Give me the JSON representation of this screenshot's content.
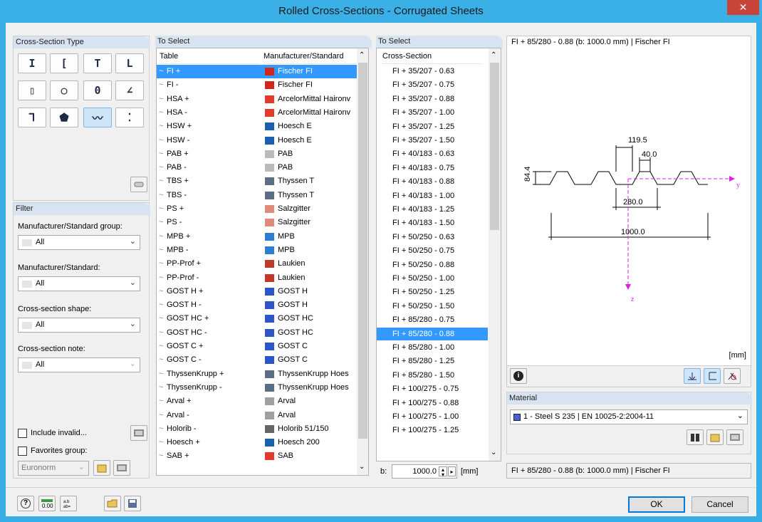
{
  "window": {
    "title": "Rolled Cross-Sections - Corrugated Sheets",
    "close": "✕"
  },
  "cross_section_type": {
    "header": "Cross-Section Type",
    "shapes": [
      "I-section",
      "channel-section",
      "tee-section",
      "angle-section",
      "rect-hollow-section",
      "circle-hollow-section",
      "round-bar-section",
      "unequal-angle-section",
      "z-section",
      "special-section",
      "corrugated-section",
      "stacked-section"
    ],
    "selected": "corrugated-section"
  },
  "filter": {
    "header": "Filter",
    "group_label": "Manufacturer/Standard group:",
    "group_value": "All",
    "mfr_label": "Manufacturer/Standard:",
    "mfr_value": "All",
    "shape_label": "Cross-section shape:",
    "shape_value": "All",
    "note_label": "Cross-section note:",
    "note_value": "All",
    "include_invalid": "Include invalid...",
    "favorites": "Favorites group:",
    "favorites_value": "Euronorm"
  },
  "tables": {
    "header": "To Select",
    "col1": "Table",
    "col2": "Manufacturer/Standard",
    "rows": [
      {
        "t": "FI +",
        "m": "Fischer FI",
        "c": "#d2261c"
      },
      {
        "t": "FI -",
        "m": "Fischer FI",
        "c": "#d2261c"
      },
      {
        "t": "HSA +",
        "m": "ArcelorMittal Haironv",
        "c": "#e23a2c"
      },
      {
        "t": "HSA -",
        "m": "ArcelorMittal Haironv",
        "c": "#e23a2c"
      },
      {
        "t": "HSW +",
        "m": "Hoesch E",
        "c": "#1b5fb0"
      },
      {
        "t": "HSW -",
        "m": "Hoesch E",
        "c": "#1b5fb0"
      },
      {
        "t": "PAB +",
        "m": "PAB",
        "c": "#bbbbbb"
      },
      {
        "t": "PAB -",
        "m": "PAB",
        "c": "#bbbbbb"
      },
      {
        "t": "TBS +",
        "m": "Thyssen T",
        "c": "#5a6e86"
      },
      {
        "t": "TBS -",
        "m": "Thyssen T",
        "c": "#5a6e86"
      },
      {
        "t": "PS +",
        "m": "Salzgitter",
        "c": "#e08a7a"
      },
      {
        "t": "PS -",
        "m": "Salzgitter",
        "c": "#e08a7a"
      },
      {
        "t": "MPB +",
        "m": "MPB",
        "c": "#2c7fd0"
      },
      {
        "t": "MPB -",
        "m": "MPB",
        "c": "#2c7fd0"
      },
      {
        "t": "PP-Prof +",
        "m": "Laukien",
        "c": "#c0392b"
      },
      {
        "t": "PP-Prof -",
        "m": "Laukien",
        "c": "#c0392b"
      },
      {
        "t": "GOST H +",
        "m": "GOST H",
        "c": "#2f56c6"
      },
      {
        "t": "GOST H -",
        "m": "GOST H",
        "c": "#2f56c6"
      },
      {
        "t": "GOST HC +",
        "m": "GOST HC",
        "c": "#2f56c6"
      },
      {
        "t": "GOST HC -",
        "m": "GOST HC",
        "c": "#2f56c6"
      },
      {
        "t": "GOST C +",
        "m": "GOST C",
        "c": "#2f56c6"
      },
      {
        "t": "GOST C -",
        "m": "GOST C",
        "c": "#2f56c6"
      },
      {
        "t": "ThyssenKrupp +",
        "m": "ThyssenKrupp Hoes",
        "c": "#5a6e86"
      },
      {
        "t": "ThyssenKrupp -",
        "m": "ThyssenKrupp Hoes",
        "c": "#5a6e86"
      },
      {
        "t": "Arval +",
        "m": "Arval",
        "c": "#a0a0a0"
      },
      {
        "t": "Arval -",
        "m": "Arval",
        "c": "#a0a0a0"
      },
      {
        "t": "Holorib -",
        "m": "Holorib 51/150",
        "c": "#666666"
      },
      {
        "t": "Hoesch +",
        "m": "Hoesch 200",
        "c": "#1b5fb0"
      },
      {
        "t": "SAB +",
        "m": "SAB",
        "c": "#e23a2c"
      }
    ],
    "selected": 0
  },
  "sections": {
    "header": "To Select",
    "col": "Cross-Section",
    "rows": [
      "FI + 35/207 - 0.63",
      "FI + 35/207 - 0.75",
      "FI + 35/207 - 0.88",
      "FI + 35/207 - 1.00",
      "FI + 35/207 - 1.25",
      "FI + 35/207 - 1.50",
      "FI + 40/183 - 0.63",
      "FI + 40/183 - 0.75",
      "FI + 40/183 - 0.88",
      "FI + 40/183 - 1.00",
      "FI + 40/183 - 1.25",
      "FI + 40/183 - 1.50",
      "FI + 50/250 - 0.63",
      "FI + 50/250 - 0.75",
      "FI + 50/250 - 0.88",
      "FI + 50/250 - 1.00",
      "FI + 50/250 - 1.25",
      "FI + 50/250 - 1.50",
      "FI + 85/280 - 0.75",
      "FI + 85/280 - 0.88",
      "FI + 85/280 - 1.00",
      "FI + 85/280 - 1.25",
      "FI + 85/280 - 1.50",
      "FI + 100/275 - 0.75",
      "FI + 100/275 - 0.88",
      "FI + 100/275 - 1.00",
      "FI + 100/275 - 1.25"
    ],
    "selected": 19,
    "b_label": "b:",
    "b_value": "1000.0",
    "b_unit": "[mm]"
  },
  "preview": {
    "title": "FI + 85/280 - 0.88 (b: 1000.0 mm) | Fischer FI",
    "dim_119": "119.5",
    "dim_40": "40.0",
    "dim_84": "84.4",
    "dim_280": "280.0",
    "dim_1000": "1000.0",
    "axis_y": "y",
    "axis_z": "z",
    "unit": "[mm]"
  },
  "material": {
    "header": "Material",
    "value": "1 - Steel S 235 | EN 10025-2:2004-11",
    "swatch": "#4a5fd0"
  },
  "summary": "FI + 85/280 - 0.88 (b: 1000.0 mm) | Fischer FI",
  "bottom": {
    "ok": "OK",
    "cancel": "Cancel"
  }
}
